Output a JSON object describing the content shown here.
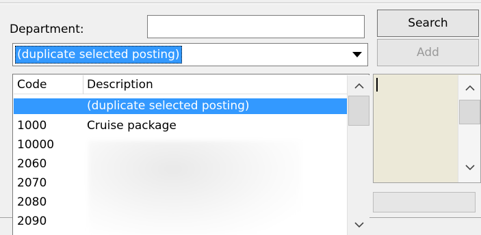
{
  "department": {
    "label": "Department:",
    "value": ""
  },
  "combo": {
    "selected": "(duplicate selected posting)"
  },
  "buttons": {
    "search": "Search",
    "add": "Add"
  },
  "list": {
    "columns": [
      "Code",
      "Description"
    ],
    "rows": [
      {
        "code": "",
        "description": "(duplicate selected posting)",
        "selected": true
      },
      {
        "code": "1000",
        "description": "Cruise package"
      },
      {
        "code": "10000",
        "description": ""
      },
      {
        "code": "2060",
        "description": ""
      },
      {
        "code": "2070",
        "description": ""
      },
      {
        "code": "2080",
        "description": ""
      },
      {
        "code": "2090",
        "description": ""
      }
    ]
  },
  "icons": {
    "combo_arrow": "triangle-down-icon",
    "scroll_up": "chevron-up-icon",
    "scroll_down": "chevron-down-icon"
  },
  "colors": {
    "selection": "#3399ff",
    "memo_background": "#ece9d8"
  }
}
